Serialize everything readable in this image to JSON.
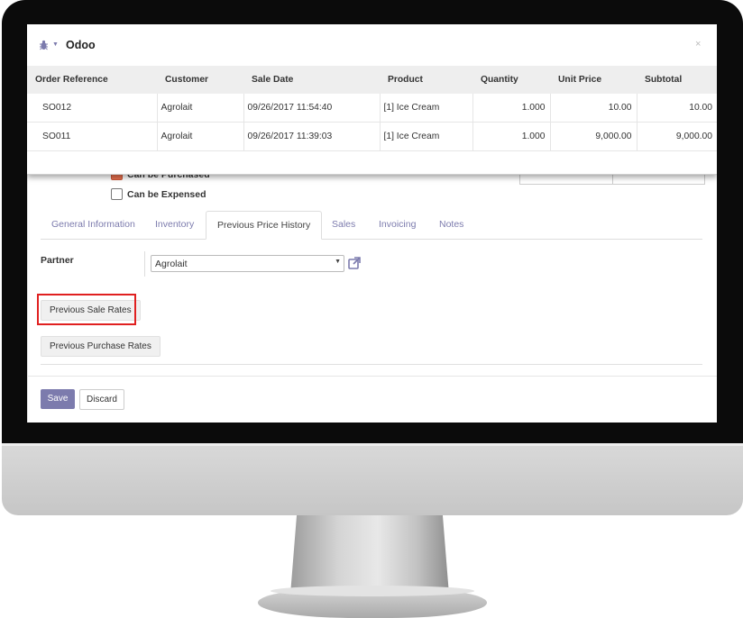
{
  "dialog": {
    "title": "Odoo",
    "close_glyph": "×",
    "columns": [
      "Order Reference",
      "Customer",
      "Sale Date",
      "Product",
      "Quantity",
      "Unit Price",
      "Subtotal"
    ],
    "rows": [
      [
        "SO012",
        "Agrolait",
        "09/26/2017 11:54:40",
        "[1] Ice Cream",
        "1.000",
        "10.00",
        "10.00"
      ],
      [
        "SO011",
        "Agrolait",
        "09/26/2017 11:39:03",
        "[1] Ice Cream",
        "1.000",
        "9,000.00",
        "9,000.00"
      ]
    ]
  },
  "form": {
    "can_be_purchased": "Can be Purchased",
    "can_be_expensed": "Can be Expensed",
    "tabs": [
      "General Information",
      "Inventory",
      "Previous Price History",
      "Sales",
      "Invoicing",
      "Notes"
    ],
    "active_tab": "Previous Price History",
    "partner_label": "Partner",
    "partner_value": "Agrolait",
    "btn_previous_sale_rates": "Previous Sale Rates",
    "btn_previous_purchase_rates": "Previous Purchase Rates",
    "save_label": "Save",
    "discard_label": "Discard"
  },
  "colors": {
    "accent": "#7c7bad",
    "highlight": "#e02020",
    "checkbox_checked": "#e8704e",
    "header_bg": "#eeeeee"
  },
  "icons": [
    "bug-icon",
    "chevron-down-icon",
    "close-icon",
    "external-link-icon"
  ]
}
